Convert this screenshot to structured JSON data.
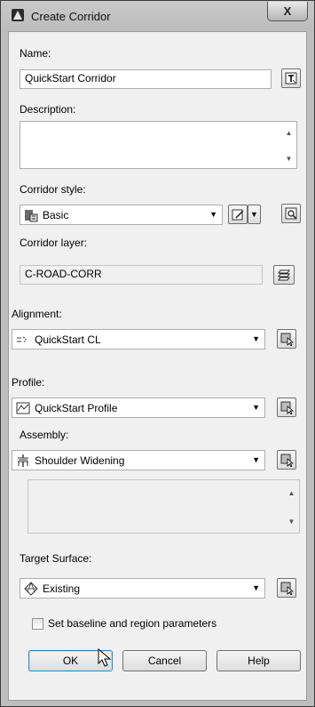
{
  "window": {
    "title": "Create Corridor",
    "close_glyph": "X"
  },
  "fields": {
    "name_label": "Name:",
    "name_value": "QuickStart Corridor",
    "description_label": "Description:",
    "description_value": "",
    "corridor_style_label": "Corridor style:",
    "corridor_style_value": "Basic",
    "corridor_layer_label": "Corridor layer:",
    "corridor_layer_value": "C-ROAD-CORR",
    "alignment_label": "Alignment:",
    "alignment_value": "QuickStart CL",
    "profile_label": "Profile:",
    "profile_value": "QuickStart Profile",
    "assembly_label": "Assembly:",
    "assembly_value": "Shoulder Widening",
    "target_surface_label": "Target Surface:",
    "target_surface_value": "Existing"
  },
  "checkbox": {
    "label": "Set baseline and region parameters",
    "checked": false
  },
  "buttons": {
    "ok": "OK",
    "cancel": "Cancel",
    "help": "Help"
  },
  "icons": {
    "app": "civil3d-icon",
    "rename": "name-template-icon",
    "style_edit": "edit-style-icon",
    "style_preview": "preview-style-icon",
    "layer": "layer-icon",
    "pick": "pick-from-drawing-icon"
  },
  "colors": {
    "default_button_border": "#3c7fb1",
    "dialog_bg": "#f0f0f0"
  }
}
